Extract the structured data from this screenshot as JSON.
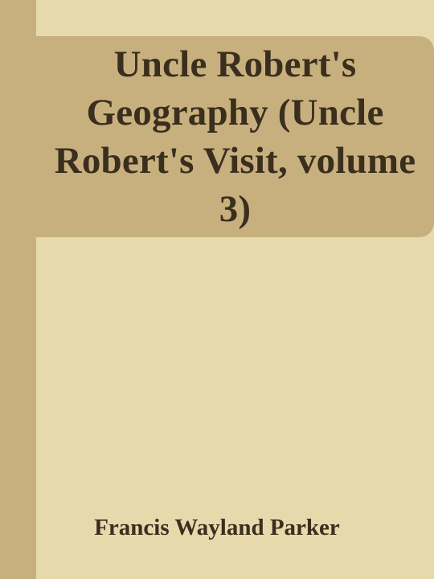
{
  "book": {
    "title": "Uncle Robert's Geography (Uncle Robert's Visit, volume 3)",
    "author": "Francis Wayland Parker"
  },
  "colors": {
    "background": "#e6d9ab",
    "spine": "#c8b07e",
    "title_panel": "#c8b07e",
    "text": "#3a2e1e"
  }
}
